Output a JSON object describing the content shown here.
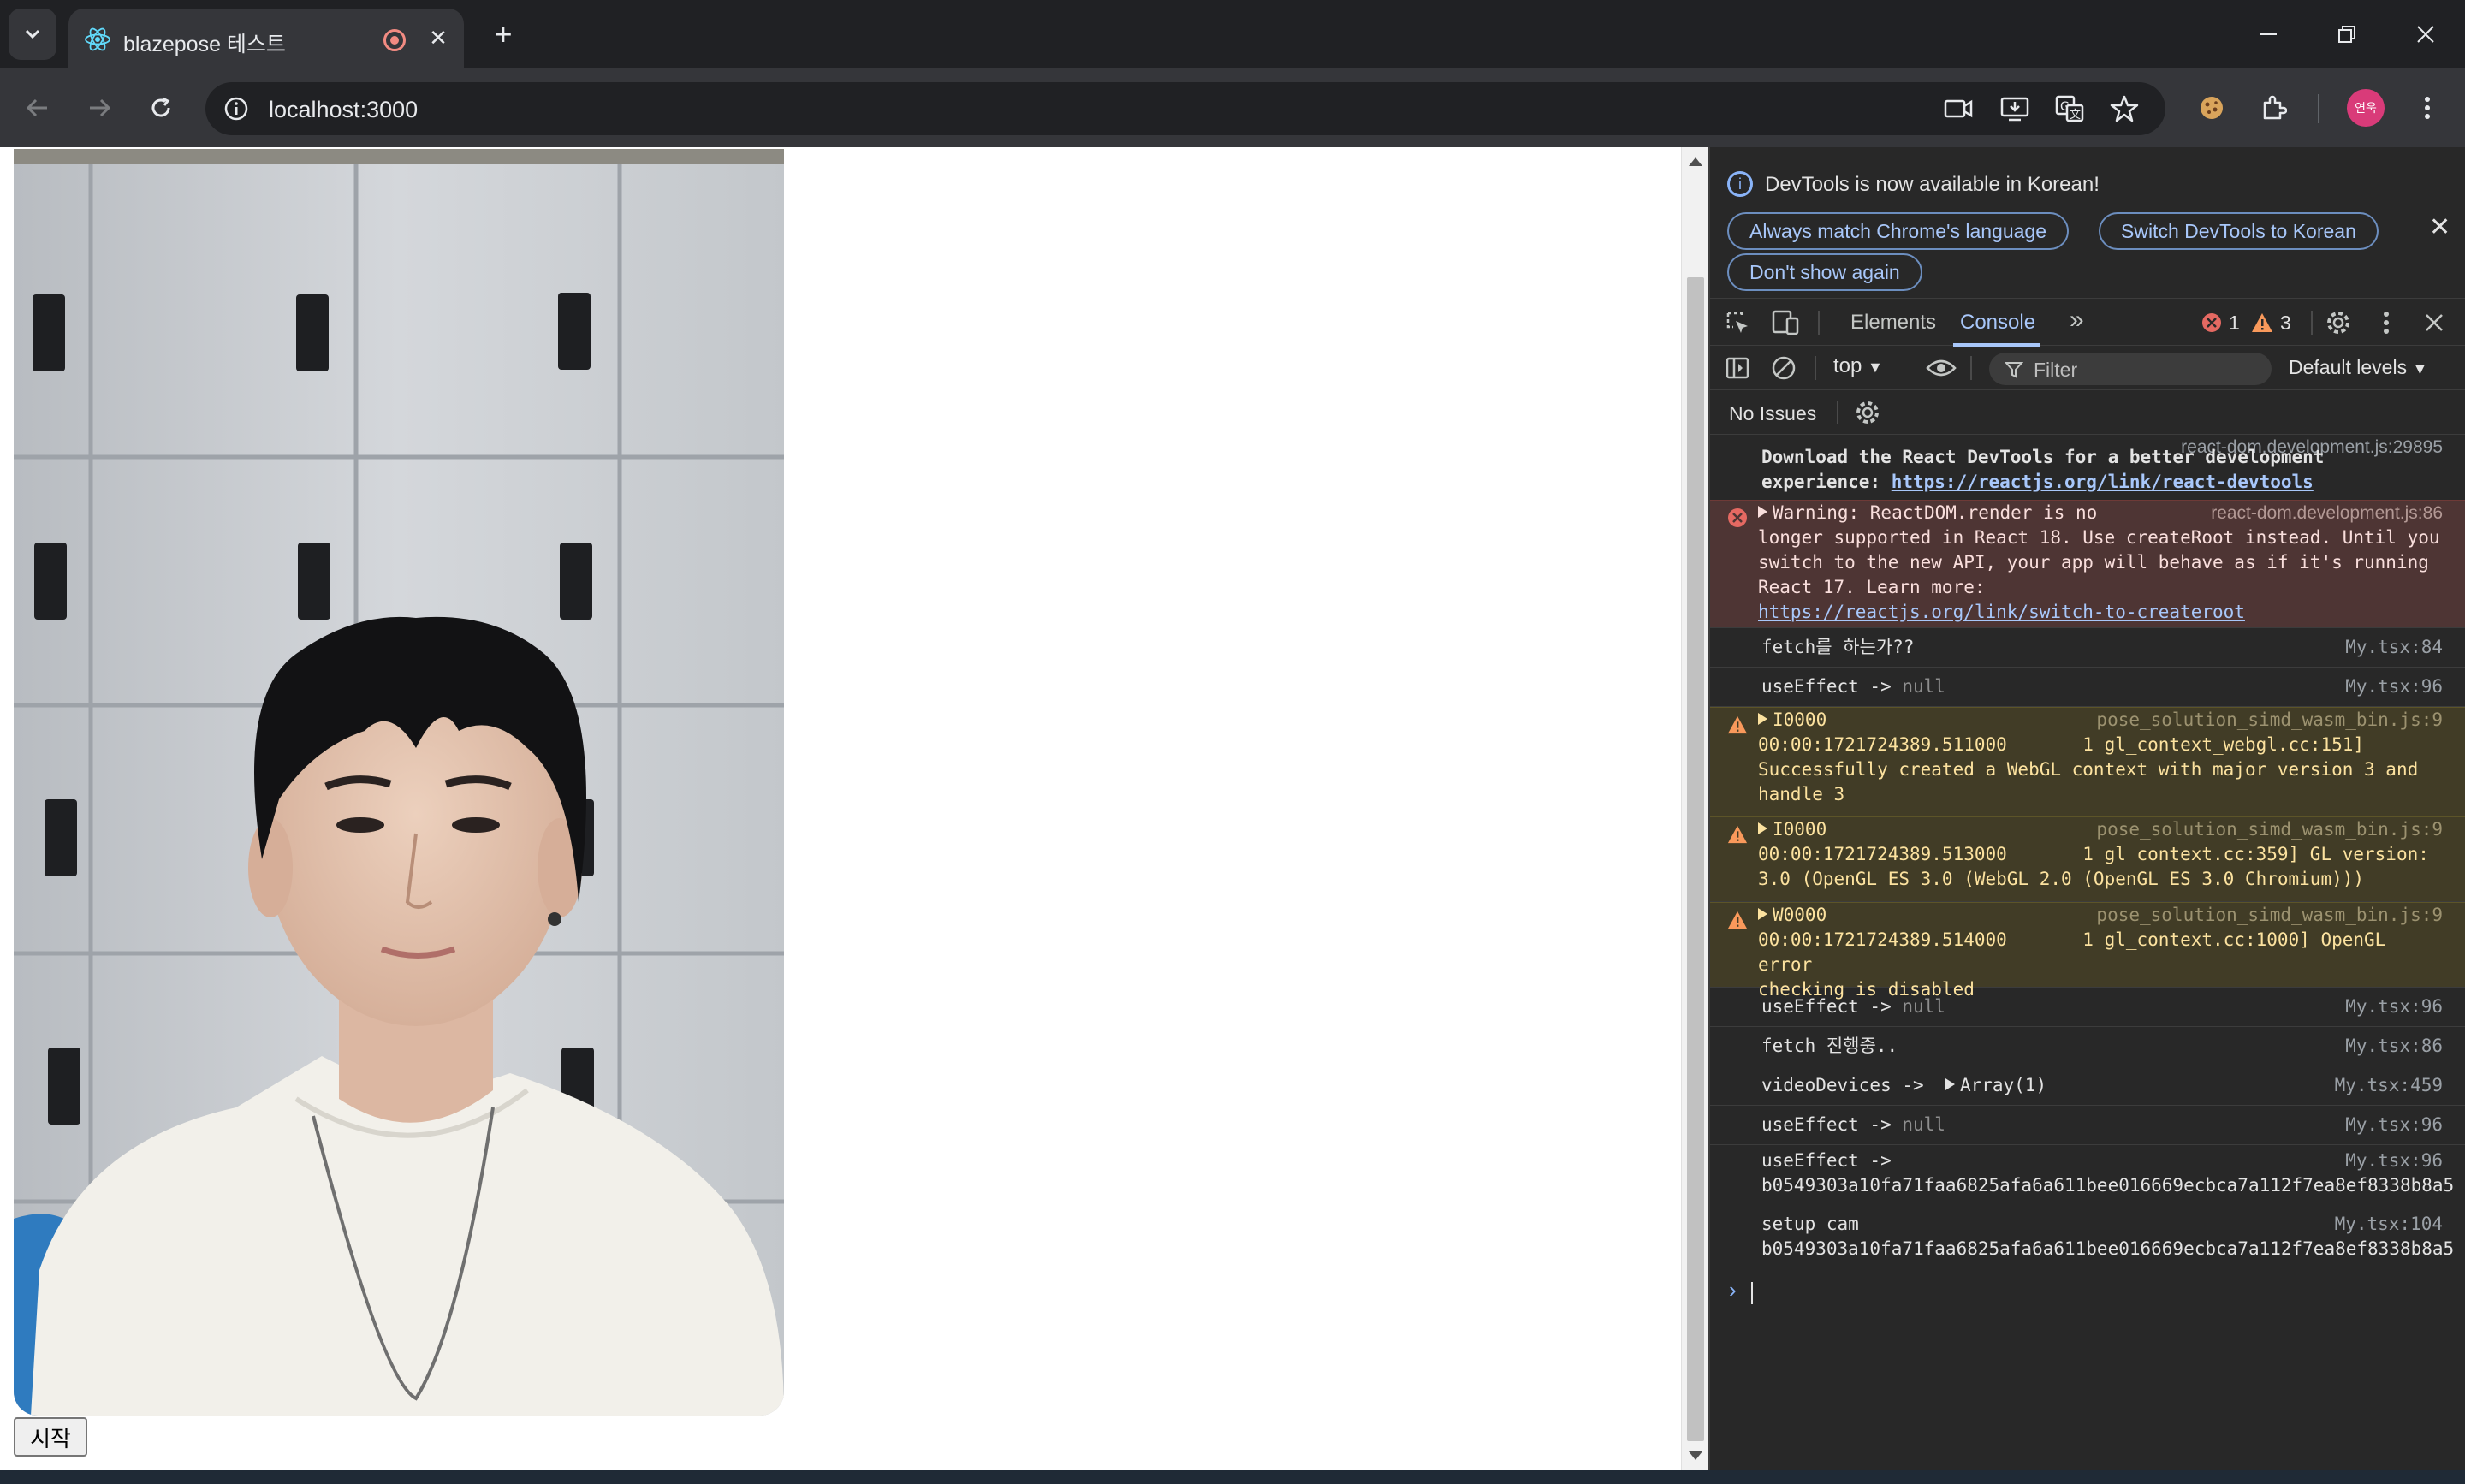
{
  "browser": {
    "tab_title": "blazepose 테스트",
    "url": "localhost:3000",
    "profile_label": "연욱",
    "icons": [
      "tab-search-icon",
      "react-favicon-icon",
      "recording-icon",
      "close-icon",
      "new-tab-icon",
      "minimize-icon",
      "restore-icon",
      "close-window-icon",
      "back-icon",
      "forward-icon",
      "reload-icon",
      "site-info-icon",
      "camera-icon",
      "install-icon",
      "translate-icon",
      "bookmark-star-icon",
      "cookie-extension-icon",
      "extensions-icon",
      "more-icon"
    ]
  },
  "page": {
    "start_button_label": "시작",
    "video_description": "webcam feed"
  },
  "devtools": {
    "banner": {
      "text": "DevTools is now available in Korean!",
      "btn_match": "Always match Chrome's language",
      "btn_switch": "Switch DevTools to Korean",
      "btn_dont_show": "Don't show again"
    },
    "tabs": {
      "elements": "Elements",
      "console": "Console",
      "more": "»"
    },
    "counts": {
      "errors": "1",
      "warnings": "3"
    },
    "filterbar": {
      "context": "top",
      "filter_placeholder": "Filter",
      "levels": "Default levels"
    },
    "issues": "No Issues",
    "messages": [
      {
        "type": "info",
        "source": "react-dom.development.js:29895",
        "bold_text": "Download the React DevTools for a better development\nexperience: ",
        "link": "https://reactjs.org/link/react-devtools"
      },
      {
        "type": "error",
        "source": "react-dom.development.js:86",
        "text_line1": "Warning: ReactDOM.render is no",
        "text_rest": "longer supported in React 18. Use createRoot instead. Until you\nswitch to the new API, your app will behave as if it's running\nReact 17. Learn more:",
        "link": "https://reactjs.org/link/switch-to-createroot"
      },
      {
        "type": "log",
        "text": "fetch를 하는가??",
        "source": "My.tsx:84"
      },
      {
        "type": "log",
        "text": "useEffect -> ",
        "value": "null",
        "source": "My.tsx:96"
      },
      {
        "type": "warn",
        "head": "I0000",
        "source": "pose_solution_simd_wasm_bin.js:9",
        "text": "00:00:1721724389.511000       1 gl_context_webgl.cc:151]\nSuccessfully created a WebGL context with major version 3 and\nhandle 3"
      },
      {
        "type": "warn",
        "head": "I0000",
        "source": "pose_solution_simd_wasm_bin.js:9",
        "text": "00:00:1721724389.513000       1 gl_context.cc:359] GL version:\n3.0 (OpenGL ES 3.0 (WebGL 2.0 (OpenGL ES 3.0 Chromium)))"
      },
      {
        "type": "warn",
        "head": "W0000",
        "source": "pose_solution_simd_wasm_bin.js:9",
        "text": "00:00:1721724389.514000       1 gl_context.cc:1000] OpenGL error\nchecking is disabled"
      },
      {
        "type": "log",
        "text": "useEffect -> ",
        "value": "null",
        "source": "My.tsx:96"
      },
      {
        "type": "log",
        "text": "fetch 진행중..",
        "source": "My.tsx:86"
      },
      {
        "type": "log",
        "text": "videoDevices -> ",
        "expand": "Array(1)",
        "source": "My.tsx:459"
      },
      {
        "type": "log",
        "text": "useEffect -> ",
        "value": "null",
        "source": "My.tsx:96"
      },
      {
        "type": "log",
        "text": "useEffect ->",
        "text2": "b0549303a10fa71faa6825afa6a611bee016669ecbca7a112f7ea8ef8338b8a5",
        "source": "My.tsx:96"
      },
      {
        "type": "log",
        "text": "setup cam",
        "text2": "b0549303a10fa71faa6825afa6a611bee016669ecbca7a112f7ea8ef8338b8a5",
        "source": "My.tsx:104"
      }
    ],
    "prompt": "›"
  }
}
